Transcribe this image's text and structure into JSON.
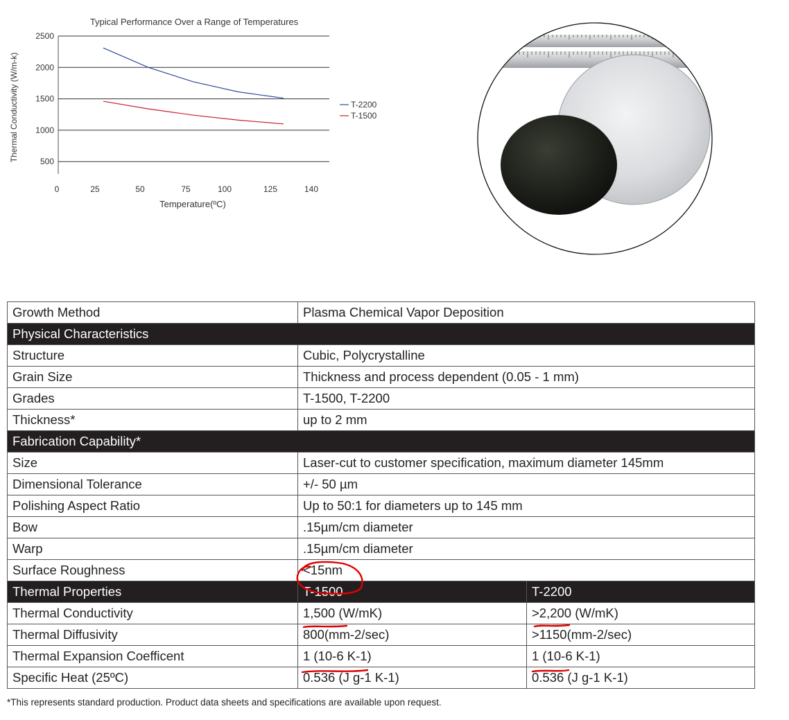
{
  "chart_data": {
    "type": "line",
    "title": "Typical Performance Over a Range of Temperatures",
    "xlabel": "Temperature(ºC)",
    "ylabel": "Thermal Conductivity (W/m-k)",
    "x_ticks": [
      "0",
      "25",
      "50",
      "75",
      "100",
      "125",
      "140"
    ],
    "y_ticks": [
      "500",
      "1000",
      "1500",
      "2000",
      "2500"
    ],
    "ylim": [
      0,
      2500
    ],
    "grid": "horizontal",
    "legend_position": "right",
    "series": [
      {
        "name": "T-2200",
        "color": "#2e4a9a",
        "x": [
          25,
          50,
          75,
          100,
          125
        ],
        "y": [
          2310,
          2000,
          1770,
          1610,
          1510
        ]
      },
      {
        "name": "T-1500",
        "color": "#c8202f",
        "x": [
          25,
          50,
          75,
          100,
          125
        ],
        "y": [
          1460,
          1340,
          1240,
          1160,
          1100
        ]
      }
    ]
  },
  "table": {
    "growth_method": {
      "label": "Growth Method",
      "value": "Plasma Chemical Vapor Deposition"
    },
    "physical": {
      "header": "Physical Characteristics",
      "rows": [
        {
          "label": "Structure",
          "value": "Cubic, Polycrystalline"
        },
        {
          "label": "Grain Size",
          "value": "Thickness and process dependent (0.05 - 1 mm)"
        },
        {
          "label": "Grades",
          "value": "T-1500, T-2200"
        },
        {
          "label": "Thickness*",
          "value": "up to 2 mm"
        }
      ]
    },
    "fabrication": {
      "header": "Fabrication Capability*",
      "rows": [
        {
          "label": "Size",
          "value": "Laser-cut to customer specification, maximum diameter 145mm"
        },
        {
          "label": "Dimensional Tolerance",
          "value": "+/- 50 µm"
        },
        {
          "label": "Polishing Aspect Ratio",
          "value": "Up to 50:1 for diameters up to 145 mm"
        },
        {
          "label": "Bow",
          "value": ".15µm/cm diameter"
        },
        {
          "label": "Warp",
          "value": ".15µm/cm diameter"
        },
        {
          "label": "Surface Roughness",
          "value": "<15nm"
        }
      ]
    },
    "thermal": {
      "header": "Thermal Properties",
      "col1": "T-1500",
      "col2": "T-2200",
      "rows": [
        {
          "label": "Thermal Conductivity",
          "t1500": "1,500 (W/mK)",
          "t2200": ">2,200 (W/mK)"
        },
        {
          "label": "Thermal Diffusivity",
          "t1500": "800(mm-2/sec)",
          "t2200": ">1150(mm-2/sec)"
        },
        {
          "label": "Thermal Expansion Coefficent",
          "t1500": "1 (10-6 K-1)",
          "t2200": "1 (10-6 K-1)"
        },
        {
          "label": "Specific Heat (25ºC)",
          "t1500": "0.536 (J g-1 K-1)",
          "t2200": "0.536 (J g-1 K-1)"
        }
      ]
    }
  },
  "footnote": "*This represents standard production. Product data sheets and specifications are available upon request.",
  "annotation_color": "#e00000"
}
